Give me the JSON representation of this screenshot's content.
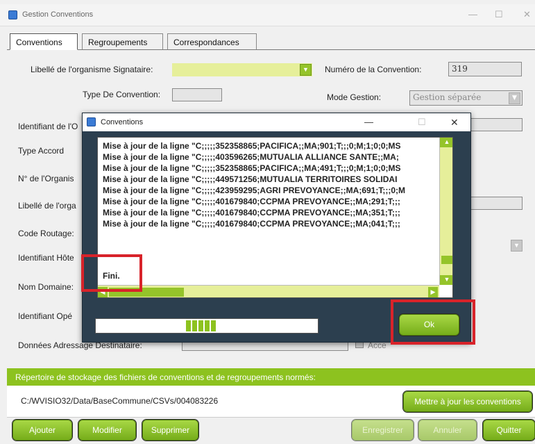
{
  "window": {
    "title": "Gestion Conventions",
    "minimize": "—",
    "maximize": "☐",
    "close": "✕"
  },
  "tabs": [
    "Conventions",
    "Regroupements",
    "Correspondances"
  ],
  "form": {
    "libelle_signataire_label": "Libellé de l'organisme Signataire:",
    "numero_label": "Numéro de la Convention:",
    "numero_value": "319",
    "type_convention_label": "Type De Convention:",
    "mode_gestion_label": "Mode Gestion:",
    "mode_gestion_value": "Gestion séparée",
    "identifiant_label": "Identifiant de l'O",
    "type_accord_label": "Type Accord",
    "num_organisme_label": "N° de l'Organis",
    "libelle_org_label": "Libellé de l'orga",
    "code_routage_label": "Code Routage:",
    "identifiant_hote_label": "Identifiant Hôte",
    "nom_domaine_label": "Nom Domaine:",
    "identifiant_ope_label": "Identifiant Opé",
    "donnees_adressage_label": "Données Adressage Destinataire:",
    "accept_label": "Acce"
  },
  "storage": {
    "label": "Répertoire de stockage des fichiers de conventions et de regroupements normés:",
    "path": "C:/WVISIO32/Data/BaseCommune/CSVs/004083226",
    "update_button": "Mettre à jour les conventions"
  },
  "buttons": {
    "ajouter": "Ajouter",
    "modifier": "Modifier",
    "supprimer": "Supprimer",
    "enregistrer": "Enregistrer",
    "annuler": "Annuler",
    "quitter": "Quitter"
  },
  "dialog": {
    "title": "Conventions",
    "minimize": "—",
    "maximize": "☐",
    "close": "✕",
    "log_lines": [
      "Mise à jour de la ligne \"C;;;;;352358865;PACIFICA;;MA;901;T;;;0;M;1;0;0;MS",
      "Mise à jour de la ligne \"C;;;;;403596265;MUTUALIA ALLIANCE SANTE;;MA;",
      "Mise à jour de la ligne \"C;;;;;352358865;PACIFICA;;MA;491;T;;;0;M;1;0;0;MS",
      "Mise à jour de la ligne \"C;;;;;449571256;MUTUALIA TERRITOIRES SOLIDAI",
      "Mise à jour de la ligne \"C;;;;;423959295;AGRI PREVOYANCE;;MA;691;T;;;0;M",
      "Mise à jour de la ligne \"C;;;;;401679840;CCPMA PREVOYANCE;;MA;291;T;;;",
      "Mise à jour de la ligne \"C;;;;;401679840;CCPMA PREVOYANCE;;MA;351;T;;;",
      "Mise à jour de la ligne \"C;;;;;401679840;CCPMA PREVOYANCE;;MA;041;T;;;"
    ],
    "final_line": "Fini.",
    "ok_button": "Ok"
  },
  "colors": {
    "accent_green": "#8dc21f",
    "dialog_bg": "#2c3f4f",
    "highlight_red": "#d8232a"
  }
}
